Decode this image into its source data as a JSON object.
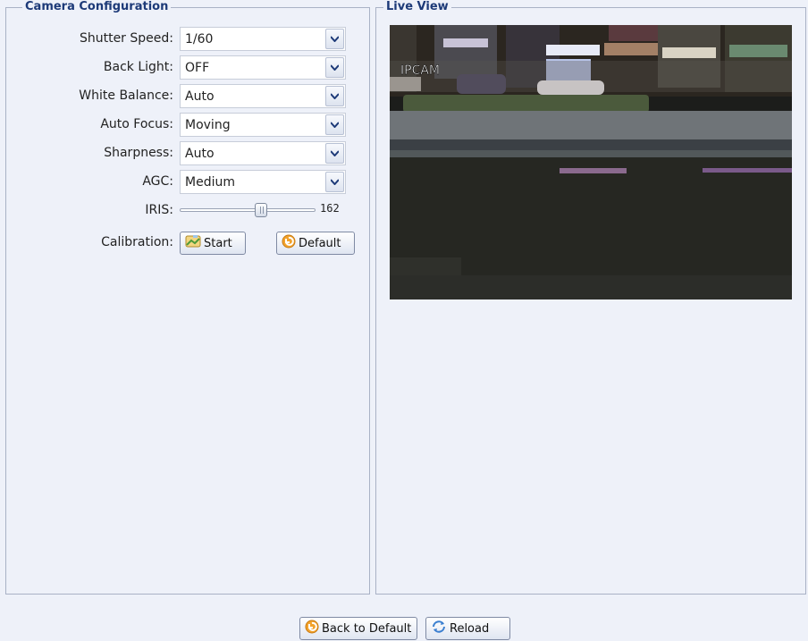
{
  "camera_config": {
    "title": "Camera Configuration",
    "fields": [
      {
        "label": "Shutter Speed:",
        "value": "1/60"
      },
      {
        "label": "Back Light:",
        "value": "OFF"
      },
      {
        "label": "White Balance:",
        "value": "Auto"
      },
      {
        "label": "Auto Focus:",
        "value": "Moving"
      },
      {
        "label": "Sharpness:",
        "value": "Auto"
      },
      {
        "label": "AGC:",
        "value": "Medium"
      }
    ],
    "iris": {
      "label": "IRIS:",
      "value": "162",
      "level": 0.6
    },
    "calibration": {
      "label": "Calibration:",
      "start_label": "Start",
      "default_label": "Default"
    }
  },
  "live_view": {
    "title": "Live View",
    "overlay_text": "IPCAM"
  },
  "footer": {
    "back_to_default_label": "Back to Default",
    "reload_label": "Reload"
  },
  "icons": {
    "dropdown": "chevron-down-icon",
    "start": "camera-icon",
    "default": "undo-arrow-icon",
    "reload": "refresh-icon"
  }
}
